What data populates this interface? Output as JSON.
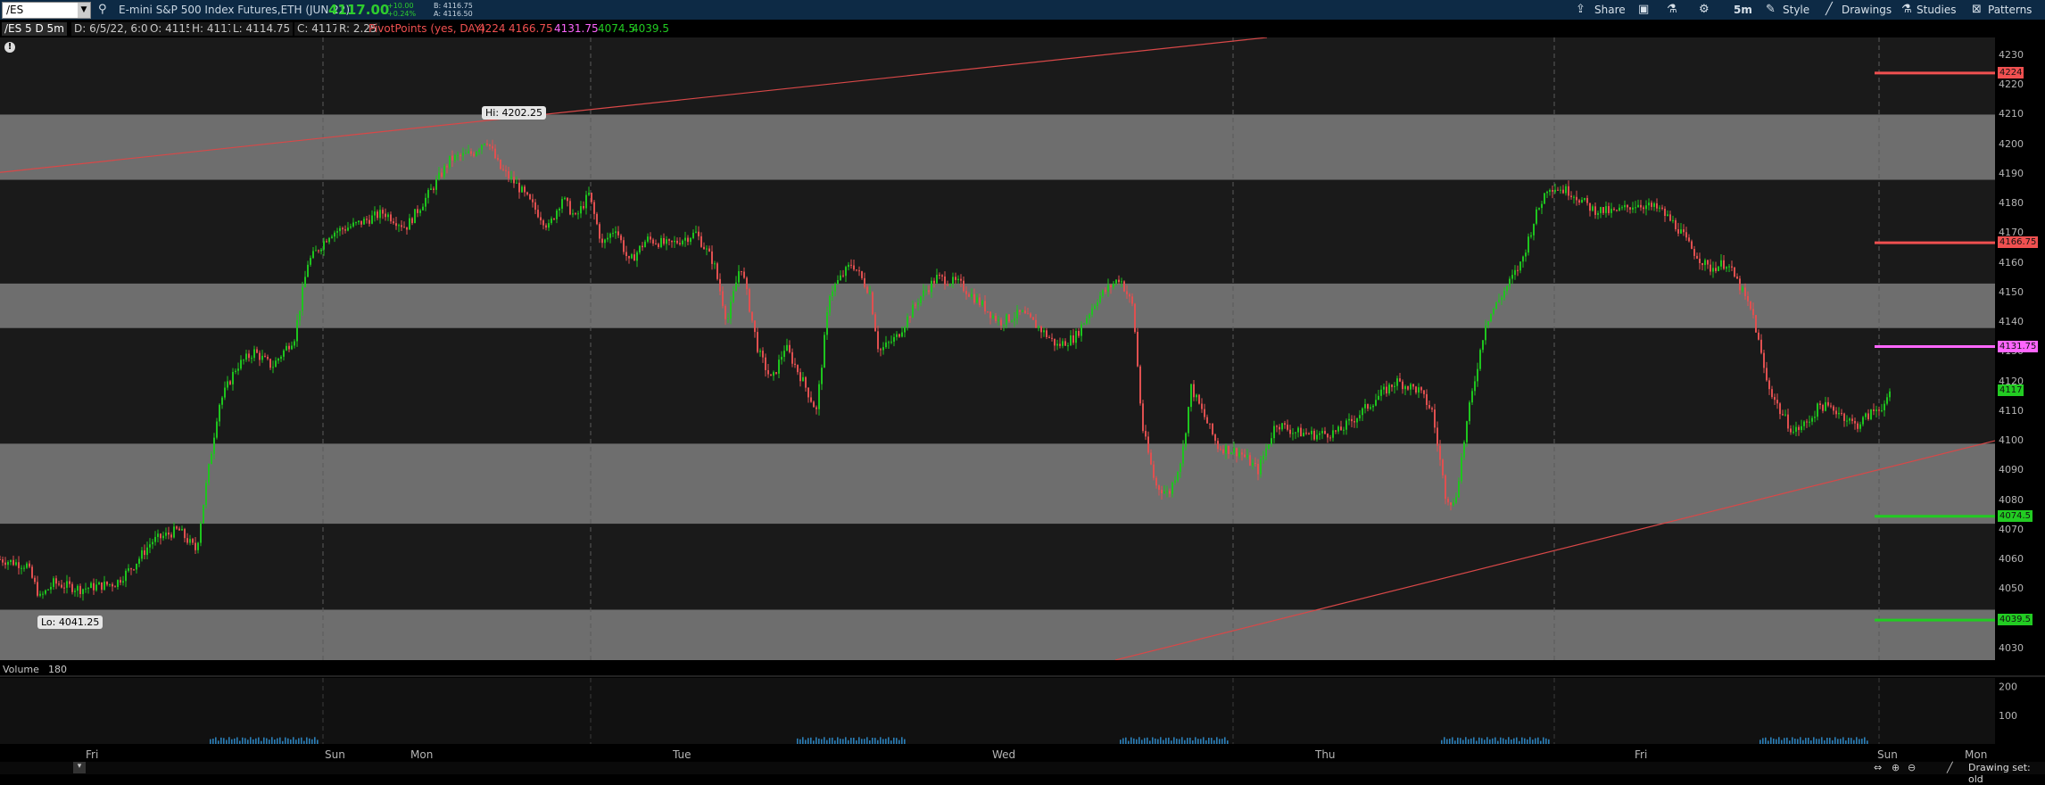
{
  "header": {
    "symbol": "/ES",
    "description": "E-mini S&P 500 Index Futures,ETH (JUN 22)",
    "last_price": "4117.00",
    "change_abs": "+10.00",
    "change_pct": "+0.24%",
    "bid": "B: 4116.75",
    "ask": "A: 4116.50",
    "toolbar": {
      "share": "Share",
      "interval": "5m",
      "style": "Style",
      "drawings": "Drawings",
      "studies": "Studies",
      "patterns": "Patterns"
    }
  },
  "info": {
    "chart_id": "/ES 5 D 5m",
    "date": "D: 6/5/22, 6:05 PM",
    "open": "O: 4115",
    "high": "H: 4117",
    "low": "L: 4114.75",
    "close": "C: 4117",
    "range": "R: 2.25",
    "study": "PivotPoints (yes, DAY)",
    "pivots": [
      "4224",
      "4166.75",
      "4131.75",
      "4074.5",
      "4039.5"
    ]
  },
  "volume": {
    "label": "Volume",
    "value": "180"
  },
  "status": {
    "drawing_set": "Drawing set: old"
  },
  "colors": {
    "up": "#1ec41e",
    "down": "#e05050",
    "resistance": "#f05050",
    "pivot": "#ff66ff",
    "support": "#22cc22",
    "zone": "#6e6e6e"
  },
  "chart_data": {
    "type": "candlestick",
    "title": "E-mini S&P 500 Index Futures,ETH (JUN 22)",
    "y_ticks": [
      4030,
      4040,
      4050,
      4060,
      4070,
      4080,
      4090,
      4100,
      4110,
      4120,
      4130,
      4140,
      4150,
      4160,
      4170,
      4180,
      4190,
      4200,
      4210,
      4220,
      4230
    ],
    "ylim": [
      4026,
      4236
    ],
    "x_labels": [
      "Fri",
      "Sun",
      "Mon",
      "Tue",
      "Wed",
      "Thu",
      "Fri",
      "Sun",
      "Mon"
    ],
    "volume_ticks": [
      100,
      200
    ],
    "annotations": {
      "high": "Hi: 4202.25",
      "low": "Lo: 4041.25"
    },
    "levels": [
      {
        "label": "4224",
        "value": 4224,
        "kind": "resistance"
      },
      {
        "label": "4166.75",
        "value": 4166.75,
        "kind": "resistance"
      },
      {
        "label": "4131.75",
        "value": 4131.75,
        "kind": "pivot"
      },
      {
        "label": "4074.5",
        "value": 4074.5,
        "kind": "support"
      },
      {
        "label": "4039.5",
        "value": 4039.5,
        "kind": "support"
      }
    ],
    "last_label": "4117",
    "last_value": 4117,
    "zones": [
      [
        4188,
        4210
      ],
      [
        4138,
        4153
      ],
      [
        4072,
        4099
      ],
      [
        4026,
        4043
      ]
    ],
    "price_path": [
      [
        0,
        4060
      ],
      [
        30,
        4058
      ],
      [
        45,
        4047
      ],
      [
        60,
        4052
      ],
      [
        90,
        4050
      ],
      [
        130,
        4052
      ],
      [
        150,
        4058
      ],
      [
        170,
        4066
      ],
      [
        200,
        4070
      ],
      [
        220,
        4063
      ],
      [
        230,
        4083
      ],
      [
        245,
        4112
      ],
      [
        265,
        4125
      ],
      [
        285,
        4130
      ],
      [
        305,
        4125
      ],
      [
        330,
        4135
      ],
      [
        345,
        4160
      ],
      [
        370,
        4170
      ],
      [
        400,
        4173
      ],
      [
        430,
        4177
      ],
      [
        455,
        4172
      ],
      [
        480,
        4183
      ],
      [
        505,
        4195
      ],
      [
        530,
        4197
      ],
      [
        545,
        4202
      ],
      [
        560,
        4192
      ],
      [
        580,
        4186
      ],
      [
        600,
        4178
      ],
      [
        615,
        4172
      ],
      [
        630,
        4182
      ],
      [
        645,
        4175
      ],
      [
        660,
        4183
      ],
      [
        675,
        4166
      ],
      [
        690,
        4172
      ],
      [
        705,
        4160
      ],
      [
        725,
        4168
      ],
      [
        750,
        4166
      ],
      [
        780,
        4170
      ],
      [
        800,
        4160
      ],
      [
        815,
        4140
      ],
      [
        830,
        4160
      ],
      [
        850,
        4130
      ],
      [
        865,
        4120
      ],
      [
        880,
        4132
      ],
      [
        900,
        4120
      ],
      [
        915,
        4110
      ],
      [
        930,
        4150
      ],
      [
        955,
        4160
      ],
      [
        975,
        4150
      ],
      [
        985,
        4130
      ],
      [
        1005,
        4135
      ],
      [
        1030,
        4148
      ],
      [
        1050,
        4155
      ],
      [
        1075,
        4153
      ],
      [
        1100,
        4146
      ],
      [
        1120,
        4140
      ],
      [
        1145,
        4143
      ],
      [
        1165,
        4138
      ],
      [
        1185,
        4132
      ],
      [
        1205,
        4135
      ],
      [
        1230,
        4148
      ],
      [
        1255,
        4155
      ],
      [
        1270,
        4145
      ],
      [
        1280,
        4105
      ],
      [
        1295,
        4085
      ],
      [
        1310,
        4082
      ],
      [
        1325,
        4095
      ],
      [
        1335,
        4118
      ],
      [
        1350,
        4108
      ],
      [
        1365,
        4098
      ],
      [
        1390,
        4096
      ],
      [
        1410,
        4090
      ],
      [
        1430,
        4106
      ],
      [
        1450,
        4103
      ],
      [
        1475,
        4102
      ],
      [
        1500,
        4103
      ],
      [
        1520,
        4108
      ],
      [
        1545,
        4115
      ],
      [
        1565,
        4120
      ],
      [
        1590,
        4117
      ],
      [
        1605,
        4110
      ],
      [
        1620,
        4082
      ],
      [
        1630,
        4078
      ],
      [
        1645,
        4108
      ],
      [
        1665,
        4140
      ],
      [
        1685,
        4150
      ],
      [
        1705,
        4160
      ],
      [
        1720,
        4175
      ],
      [
        1735,
        4186
      ],
      [
        1760,
        4184
      ],
      [
        1785,
        4178
      ],
      [
        1810,
        4177
      ],
      [
        1835,
        4180
      ],
      [
        1860,
        4178
      ],
      [
        1880,
        4172
      ],
      [
        1895,
        4165
      ],
      [
        1915,
        4158
      ],
      [
        1935,
        4160
      ],
      [
        1950,
        4152
      ],
      [
        1965,
        4142
      ],
      [
        1980,
        4120
      ],
      [
        1995,
        4110
      ],
      [
        2010,
        4103
      ],
      [
        2025,
        4106
      ],
      [
        2040,
        4112
      ],
      [
        2060,
        4110
      ],
      [
        2080,
        4105
      ],
      [
        2100,
        4110
      ],
      [
        2115,
        4113
      ],
      [
        2120,
        4117
      ]
    ],
    "volume_spikes": [
      [
        345,
        180
      ],
      [
        1003,
        215
      ],
      [
        1365,
        70
      ],
      [
        1725,
        60
      ],
      [
        2082,
        60
      ]
    ]
  }
}
